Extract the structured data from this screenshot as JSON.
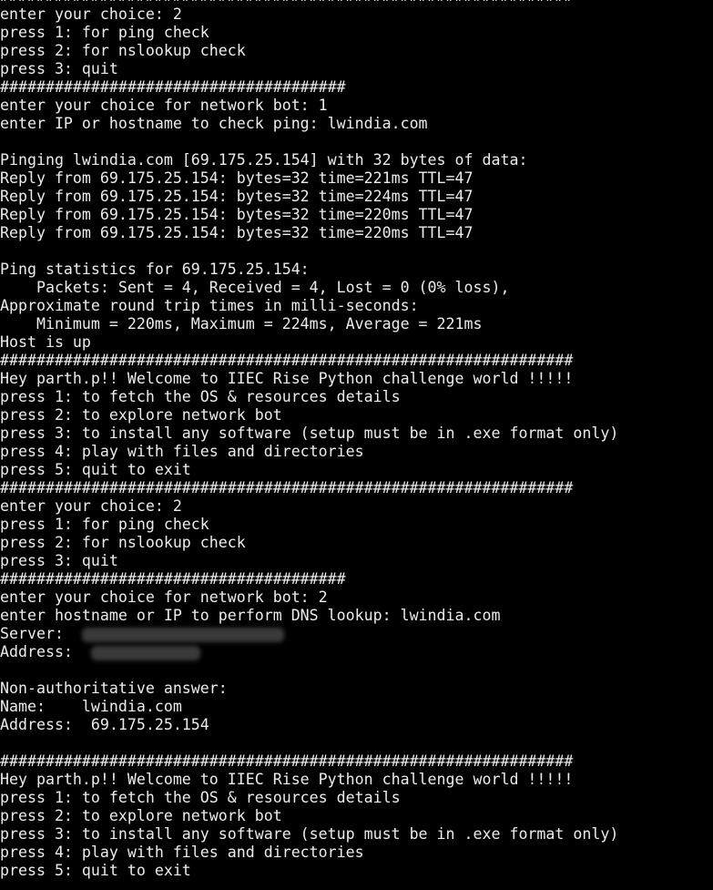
{
  "terminal": {
    "lines": [
      "###############################################################",
      "enter your choice: 2",
      "press 1: for ping check",
      "press 2: for nslookup check",
      "press 3: quit",
      "######################################",
      "enter your choice for network bot: 1",
      "enter IP or hostname to check ping: lwindia.com",
      "",
      "Pinging lwindia.com [69.175.25.154] with 32 bytes of data:",
      "Reply from 69.175.25.154: bytes=32 time=221ms TTL=47",
      "Reply from 69.175.25.154: bytes=32 time=224ms TTL=47",
      "Reply from 69.175.25.154: bytes=32 time=220ms TTL=47",
      "Reply from 69.175.25.154: bytes=32 time=220ms TTL=47",
      "",
      "Ping statistics for 69.175.25.154:",
      "    Packets: Sent = 4, Received = 4, Lost = 0 (0% loss),",
      "Approximate round trip times in milli-seconds:",
      "    Minimum = 220ms, Maximum = 224ms, Average = 221ms",
      "Host is up",
      "###############################################################",
      "Hey parth.p!! Welcome to IIEC Rise Python challenge world !!!!!",
      "press 1: to fetch the OS & resources details",
      "press 2: to explore network bot",
      "press 3: to install any software (setup must be in .exe format only)",
      "press 4: play with files and directories",
      "press 5: quit to exit",
      "###############################################################",
      "enter your choice: 2",
      "press 1: for ping check",
      "press 2: for nslookup check",
      "press 3: quit",
      "######################################",
      "enter your choice for network bot: 2",
      "enter hostname or IP to perform DNS lookup: lwindia.com",
      "Server:  ",
      "Address:  ",
      "",
      "Non-authoritative answer:",
      "Name:    lwindia.com",
      "Address:  69.175.25.154",
      "",
      "###############################################################",
      "Hey parth.p!! Welcome to IIEC Rise Python challenge world !!!!!",
      "press 1: to fetch the OS & resources details",
      "press 2: to explore network bot",
      "press 3: to install any software (setup must be in .exe format only)",
      "press 4: play with files and directories",
      "press 5: quit to exit"
    ]
  },
  "colors": {
    "background": "#000000",
    "text": "#ececec"
  }
}
